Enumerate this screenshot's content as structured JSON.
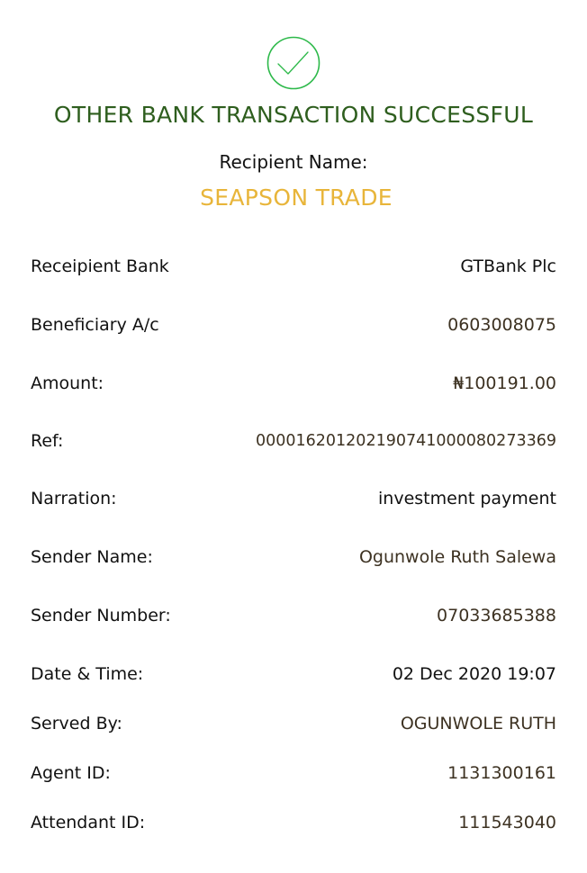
{
  "colors": {
    "success_green": "#2e5e1e",
    "check_green": "#2db94a",
    "recipient_gold": "#e8b53a",
    "value_dark": "#111111",
    "value_brown": "#3d3222"
  },
  "status": {
    "icon": "check-circle-icon",
    "title": "OTHER BANK TRANSACTION SUCCESSFUL"
  },
  "recipient": {
    "label": "Recipient Name:",
    "name": "SEAPSON TRADE"
  },
  "details": [
    {
      "key": "recipient-bank",
      "label": "Receipient Bank",
      "value": "GTBank Plc",
      "color": "#111111"
    },
    {
      "key": "beneficiary-account",
      "label": "Beneficiary A/c",
      "value": "0603008075",
      "color": "#3d3222"
    },
    {
      "key": "amount",
      "label": "Amount:",
      "value": "₦100191.00",
      "color": "#3d3222"
    },
    {
      "key": "reference",
      "label": "Ref:",
      "value": "000016201202190741000080273369",
      "color": "#3d3222"
    },
    {
      "key": "narration",
      "label": "Narration:",
      "value": "investment payment",
      "color": "#111111"
    },
    {
      "key": "sender-name",
      "label": "Sender Name:",
      "value": "Ogunwole Ruth Salewa",
      "color": "#3d3222"
    },
    {
      "key": "sender-number",
      "label": "Sender Number:",
      "value": "07033685388",
      "color": "#3d3222"
    },
    {
      "key": "date-time",
      "label": "Date & Time:",
      "value": "02 Dec 2020 19:07",
      "color": "#111111"
    },
    {
      "key": "served-by",
      "label": "Served By:",
      "value": "OGUNWOLE RUTH",
      "color": "#3d3222"
    },
    {
      "key": "agent-id",
      "label": "Agent ID:",
      "value": "1131300161",
      "color": "#3d3222"
    },
    {
      "key": "attendant-id",
      "label": "Attendant ID:",
      "value": "111543040",
      "color": "#3d3222"
    }
  ]
}
